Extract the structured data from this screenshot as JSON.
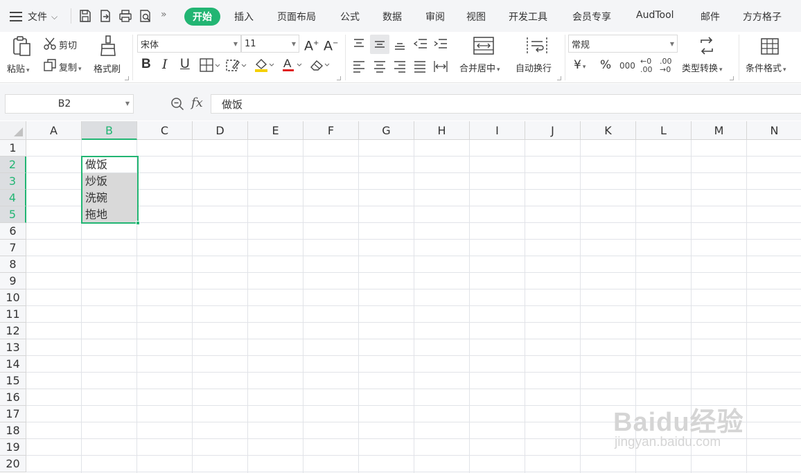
{
  "menubar": {
    "file_label": "文件",
    "quick_access": [
      "save-icon",
      "export-icon",
      "print-icon",
      "print-preview-icon"
    ],
    "tabs": [
      {
        "label": "开始",
        "active": true
      },
      {
        "label": "插入"
      },
      {
        "label": "页面布局"
      },
      {
        "label": "公式"
      },
      {
        "label": "数据"
      },
      {
        "label": "审阅"
      },
      {
        "label": "视图"
      },
      {
        "label": "开发工具"
      },
      {
        "label": "会员专享"
      },
      {
        "label": "AudTool"
      },
      {
        "label": "邮件"
      },
      {
        "label": "方方格子"
      }
    ]
  },
  "ribbon": {
    "paste_label": "粘贴",
    "cut_label": "剪切",
    "copy_label": "复制",
    "format_painter_label": "格式刷",
    "font_name": "宋体",
    "font_size": "11",
    "merge_label": "合并居中",
    "wrap_label": "自动换行",
    "number_format": "常规",
    "convert_label": "类型转换",
    "cond_format_label": "条件格式",
    "currency_symbol": "¥",
    "percent_symbol": "%",
    "thousands_symbol": "000",
    "inc_decimal": ".00",
    "dec_decimal": ".00"
  },
  "formula_bar": {
    "name_box": "B2",
    "fx_label": "fx",
    "formula": "做饭"
  },
  "sheet": {
    "columns": [
      "A",
      "B",
      "C",
      "D",
      "E",
      "F",
      "G",
      "H",
      "I",
      "J",
      "K",
      "L",
      "M",
      "N"
    ],
    "selected_column": "B",
    "rows": [
      "1",
      "2",
      "3",
      "4",
      "5",
      "6",
      "7",
      "8",
      "9",
      "10",
      "11",
      "12",
      "13",
      "14",
      "15",
      "16",
      "17",
      "18",
      "19",
      "20"
    ],
    "selected_rows": [
      "2",
      "3",
      "4",
      "5"
    ],
    "cells": {
      "B2": "做饭",
      "B3": "炒饭",
      "B4": "洗碗",
      "B5": "拖地"
    }
  },
  "colors": {
    "accent": "#22b573",
    "header_bg": "#f6f7f9",
    "selected_header_bg": "#dcdee1",
    "cell_shade": "#d9d9d9"
  },
  "watermark": {
    "brand": "Baidu经验",
    "url": "jingyan.baidu.com"
  }
}
